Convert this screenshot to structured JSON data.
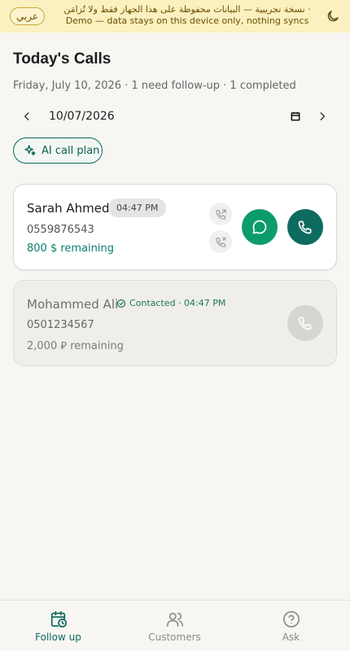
{
  "banner": {
    "lang_button": "عربي",
    "arabic_notice": "· نسخة تجريبية — البيانات محفوظة على هذا الجهاز فقط ولا تُزامَن",
    "english_notice": "Demo — data stays on this device only, nothing syncs",
    "theme_icon": "moon-icon"
  },
  "header": {
    "title": "Today's Calls",
    "subtitle": "Friday, July 10, 2026 · 1 need follow-up · 1 completed"
  },
  "date_picker": {
    "value": "10/07/2026",
    "prev_icon": "chevron-left-icon",
    "next_icon": "chevron-right-icon",
    "calendar_icon": "calendar-icon"
  },
  "ai_button": {
    "label": "AI call plan",
    "icon": "sparkles-icon"
  },
  "calls": [
    {
      "name": "Sarah Ahmed",
      "time": "04:47 PM",
      "phone": "0559876543",
      "remaining": "800 $ remaining",
      "status": "pending"
    },
    {
      "name": "Mohammed Ali",
      "contacted": "Contacted · 04:47 PM",
      "phone": "0501234567",
      "remaining": "2,000 ⃁ remaining",
      "status": "completed"
    }
  ],
  "nav": {
    "items": [
      {
        "label": "Follow up",
        "icon": "calendar-clock-icon",
        "active": true
      },
      {
        "label": "Customers",
        "icon": "users-icon",
        "active": false
      },
      {
        "label": "Ask",
        "icon": "help-circle-icon",
        "active": false
      }
    ]
  },
  "colors": {
    "banner_bg": "#fbf0c0",
    "accent": "#0e6b60",
    "whatsapp": "#0b9c6a",
    "remaining_text": "#0a7d6a"
  }
}
